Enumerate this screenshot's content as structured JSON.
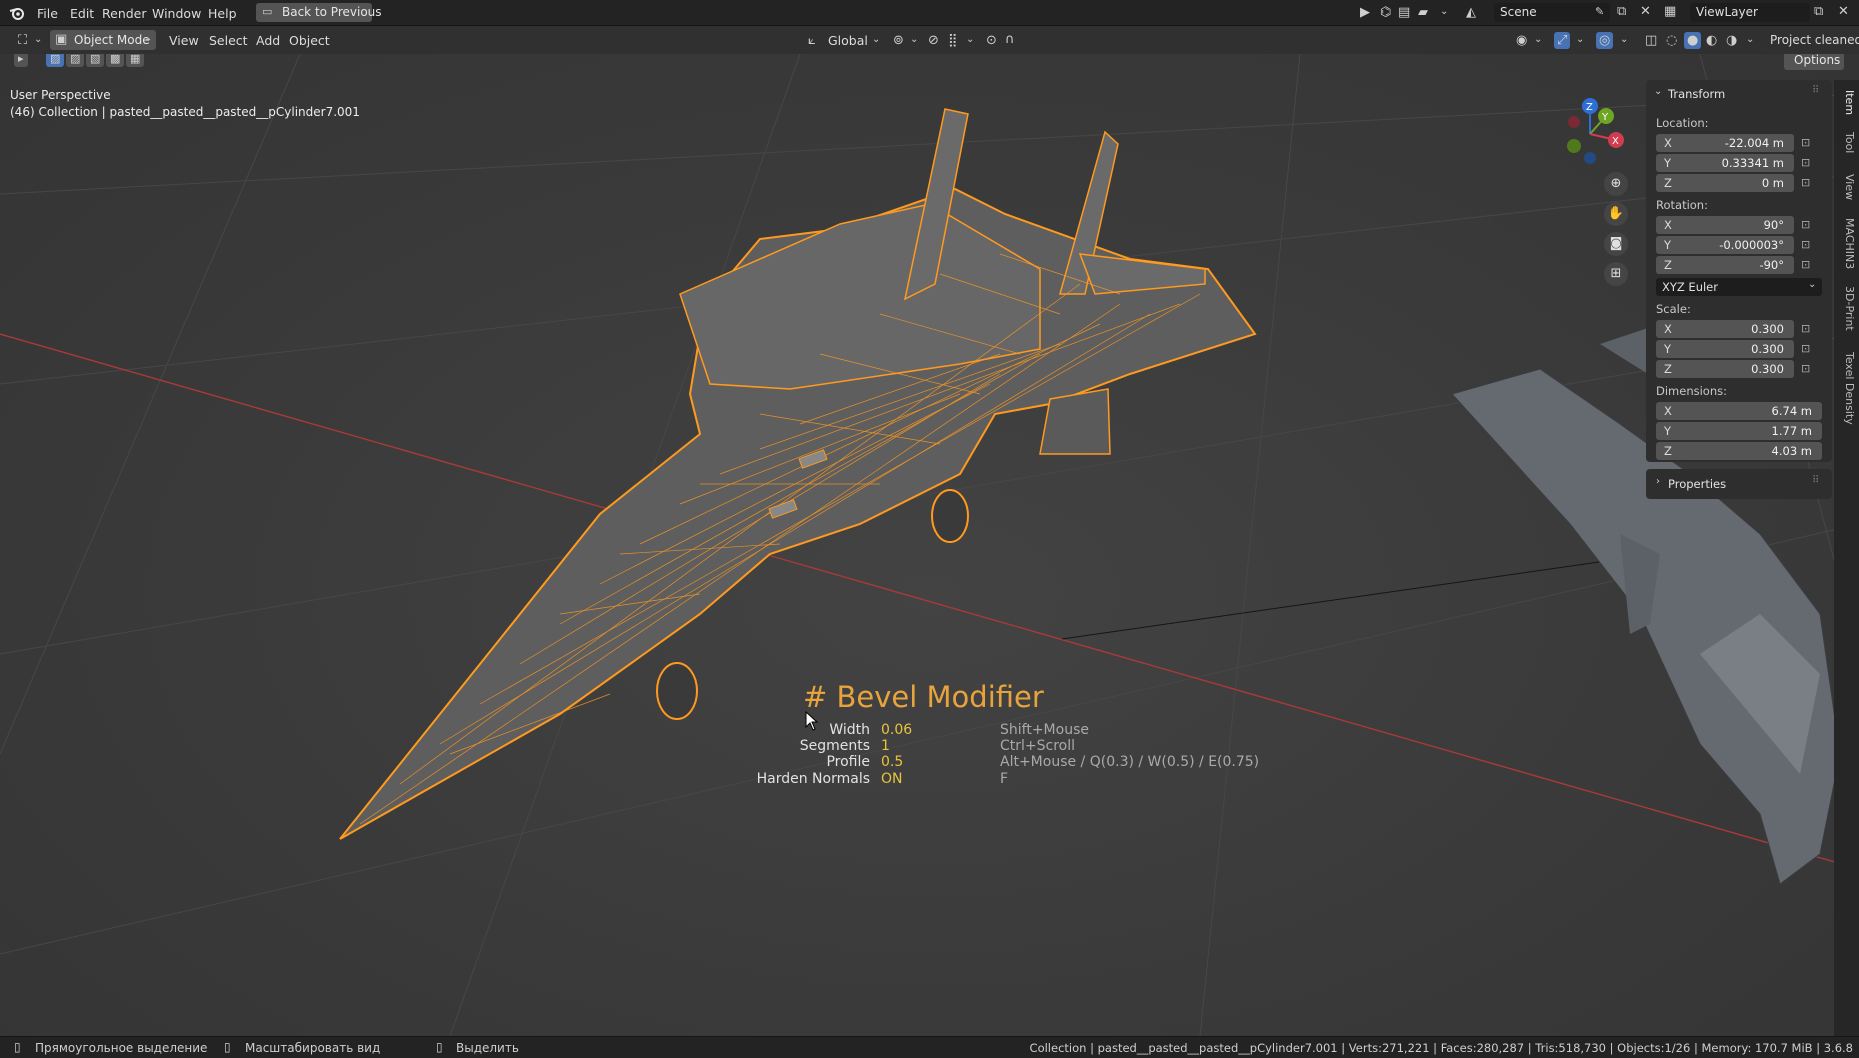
{
  "topbar": {
    "menus": [
      "File",
      "Edit",
      "Render",
      "Window",
      "Help"
    ],
    "back_button": "Back to Previous",
    "scene": "Scene",
    "view_layer": "ViewLayer"
  },
  "header": {
    "mode": "Object Mode",
    "menus": [
      "View",
      "Select",
      "Add",
      "Object"
    ],
    "orientation": "Global",
    "project_label": "Project cleaned",
    "options": "Options"
  },
  "viewport": {
    "perspective": "User Perspective",
    "collection": "(46) Collection | pasted__pasted__pasted__pCylinder7.001",
    "gizmo_axes": [
      "Z",
      "Y",
      "X"
    ]
  },
  "operator": {
    "title": "# Bevel Modifier",
    "rows": [
      {
        "label": "Width",
        "value": "0.06",
        "keys": "Shift+Mouse"
      },
      {
        "label": "Segments",
        "value": "1",
        "keys": "Ctrl+Scroll"
      },
      {
        "label": "Profile",
        "value": "0.5",
        "keys": "Alt+Mouse / Q(0.3) / W(0.5) / E(0.75)"
      },
      {
        "label": "Harden Normals",
        "value": "ON",
        "keys": "F"
      }
    ]
  },
  "transform": {
    "title": "Transform",
    "location_label": "Location:",
    "location": [
      {
        "axis": "X",
        "value": "-22.004 m"
      },
      {
        "axis": "Y",
        "value": "0.33341 m"
      },
      {
        "axis": "Z",
        "value": "0 m"
      }
    ],
    "rotation_label": "Rotation:",
    "rotation": [
      {
        "axis": "X",
        "value": "90°"
      },
      {
        "axis": "Y",
        "value": "-0.000003°"
      },
      {
        "axis": "Z",
        "value": "-90°"
      }
    ],
    "rotation_mode": "XYZ Euler",
    "scale_label": "Scale:",
    "scale": [
      {
        "axis": "X",
        "value": "0.300"
      },
      {
        "axis": "Y",
        "value": "0.300"
      },
      {
        "axis": "Z",
        "value": "0.300"
      }
    ],
    "dimensions_label": "Dimensions:",
    "dimensions": [
      {
        "axis": "X",
        "value": "6.74 m"
      },
      {
        "axis": "Y",
        "value": "1.77 m"
      },
      {
        "axis": "Z",
        "value": "4.03 m"
      }
    ],
    "properties": "Properties"
  },
  "side_tabs": [
    "Item",
    "Tool",
    "View",
    "MACHIN3",
    "3D-Print",
    "Texel Density"
  ],
  "statusbar": {
    "hint1": "Прямоугольное выделение",
    "hint2": "Масштабировать вид",
    "hint3": "Выделить",
    "stats": "Collection | pasted__pasted__pasted__pCylinder7.001 | Verts:271,221 | Faces:280,287 | Tris:518,730 | Objects:1/26 | Memory: 170.7 MiB | 3.6.8"
  },
  "colors": {
    "accent": "#e8a33c",
    "selection": "#ff9a1f",
    "x_axis": "#c83c3c"
  }
}
